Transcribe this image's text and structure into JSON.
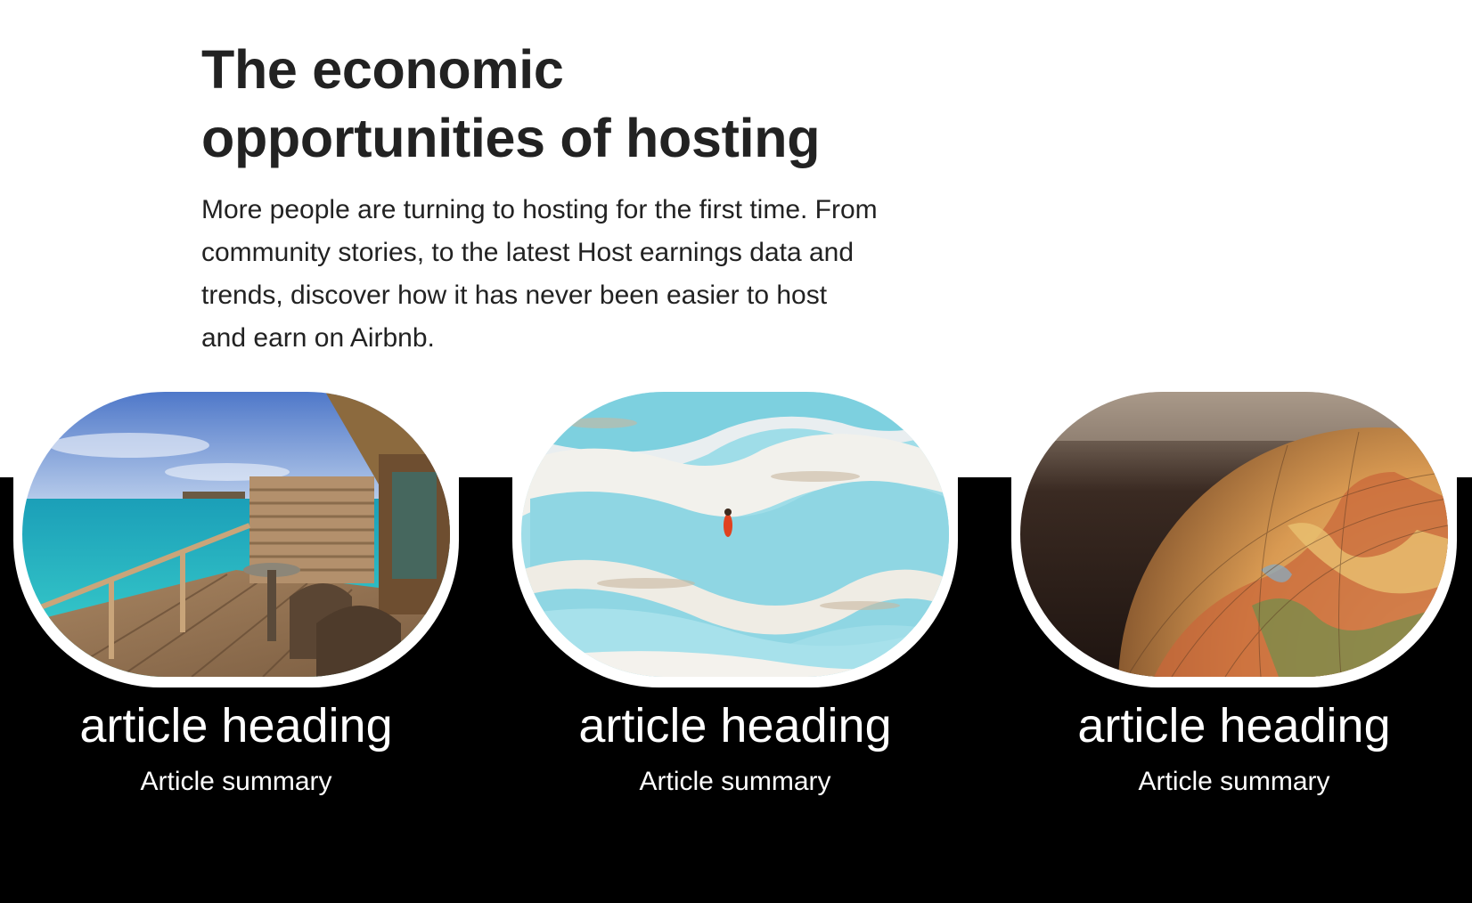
{
  "intro": {
    "title": "The economic opportunities of hosting",
    "body": "More people are turning to hosting for the first time. From community stories, to the latest Host earnings data and trends, discover how it has never been easier to host and earn on Airbnb."
  },
  "articles": [
    {
      "heading": "article heading",
      "summary": "Article summary",
      "image": "overwater-villa-deck-photo"
    },
    {
      "heading": "article heading",
      "summary": "Article summary",
      "image": "turquoise-travertine-pools-photo"
    },
    {
      "heading": "article heading",
      "summary": "Article summary",
      "image": "vintage-globe-photo"
    }
  ],
  "colors": {
    "band": "#000000",
    "title": "#222222",
    "card_text": "#ffffff"
  }
}
